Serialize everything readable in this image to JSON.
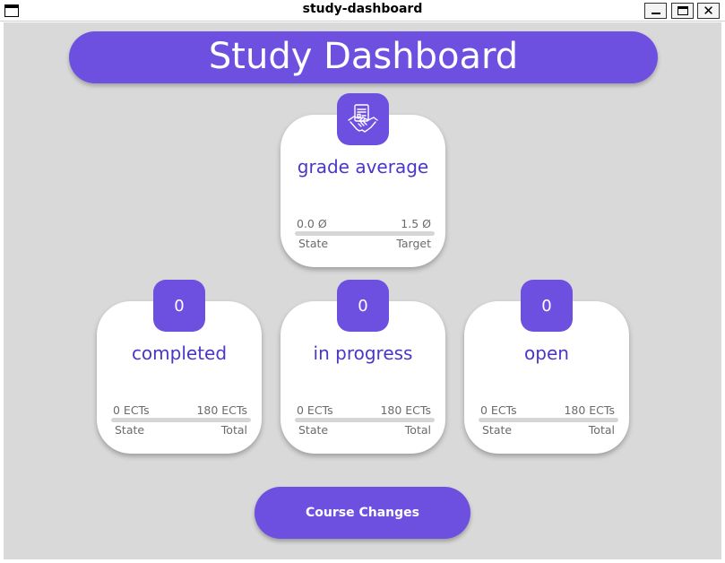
{
  "window": {
    "title": "study-dashboard",
    "close_glyph": "✕"
  },
  "header": {
    "title": "Study Dashboard"
  },
  "cards": {
    "grade": {
      "icon": "handshake-contract-icon",
      "title": "grade average",
      "value_left": "0.0 Ø",
      "value_right": "1.5 Ø",
      "label_left": "State",
      "label_right": "Target",
      "progress": 0
    },
    "completed": {
      "badge": "0",
      "title": "completed",
      "value_left": "0 ECTs",
      "value_right": "180 ECTs",
      "label_left": "State",
      "label_right": "Total",
      "progress": 0
    },
    "in_progress": {
      "badge": "0",
      "title": "in progress",
      "value_left": "0 ECTs",
      "value_right": "180 ECTs",
      "label_left": "State",
      "label_right": "Total",
      "progress": 0
    },
    "open": {
      "badge": "0",
      "title": "open",
      "value_left": "0 ECTs",
      "value_right": "180 ECTs",
      "label_left": "State",
      "label_right": "Total",
      "progress": 0
    }
  },
  "actions": {
    "course_changes_label": "Course Changes"
  },
  "colors": {
    "accent": "#6e50e0",
    "title_text": "#4a36c8",
    "background": "#d9d9d9"
  }
}
